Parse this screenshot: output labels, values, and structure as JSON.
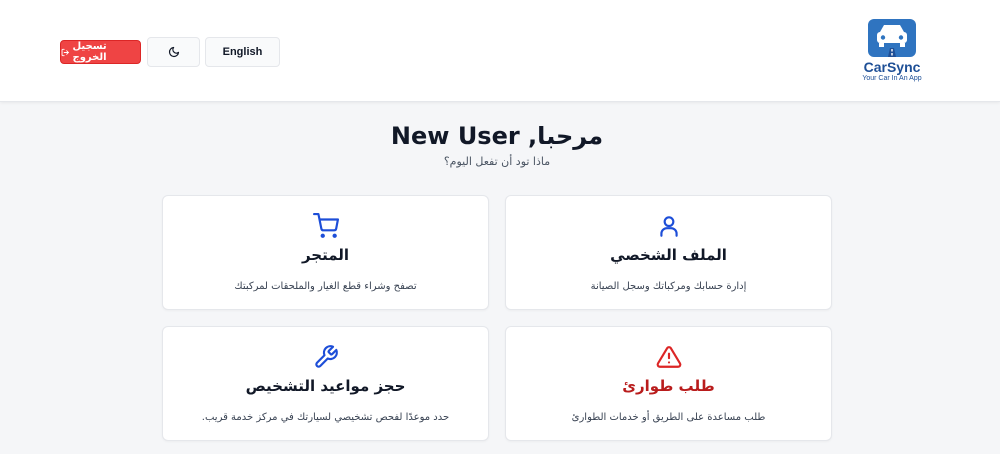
{
  "header": {
    "logo": {
      "title": "CarSync",
      "tagline": "Your Car In An App"
    },
    "language_label": "English",
    "theme_icon": "moon-icon",
    "logout_label": "تسجيل الخروج",
    "logout_icon": "logout-icon"
  },
  "welcome": {
    "title": "مرحبا, New User",
    "subtitle": "ماذا تود أن تفعل اليوم؟"
  },
  "cards": {
    "profile": {
      "icon": "user-icon",
      "title": "الملف الشخصي",
      "description": "إدارة حسابك ومركباتك وسجل الصيانة"
    },
    "store": {
      "icon": "cart-icon",
      "title": "المتجر",
      "description": "تصفح وشراء قطع الغيار والملحقات لمركبتك"
    },
    "emergency": {
      "icon": "warning-icon",
      "title": "طلب طوارئ",
      "description": "طلب مساعدة على الطريق أو خدمات الطوارئ"
    },
    "booking": {
      "icon": "wrench-icon",
      "title": "حجز مواعيد التشخيص",
      "description": "حدد موعدًا لفحص تشخيصي لسيارتك في مركز خدمة قريب."
    }
  },
  "colors": {
    "accent": "#1d4ed8",
    "danger": "#ef4444",
    "brand": "#1e4f96"
  }
}
